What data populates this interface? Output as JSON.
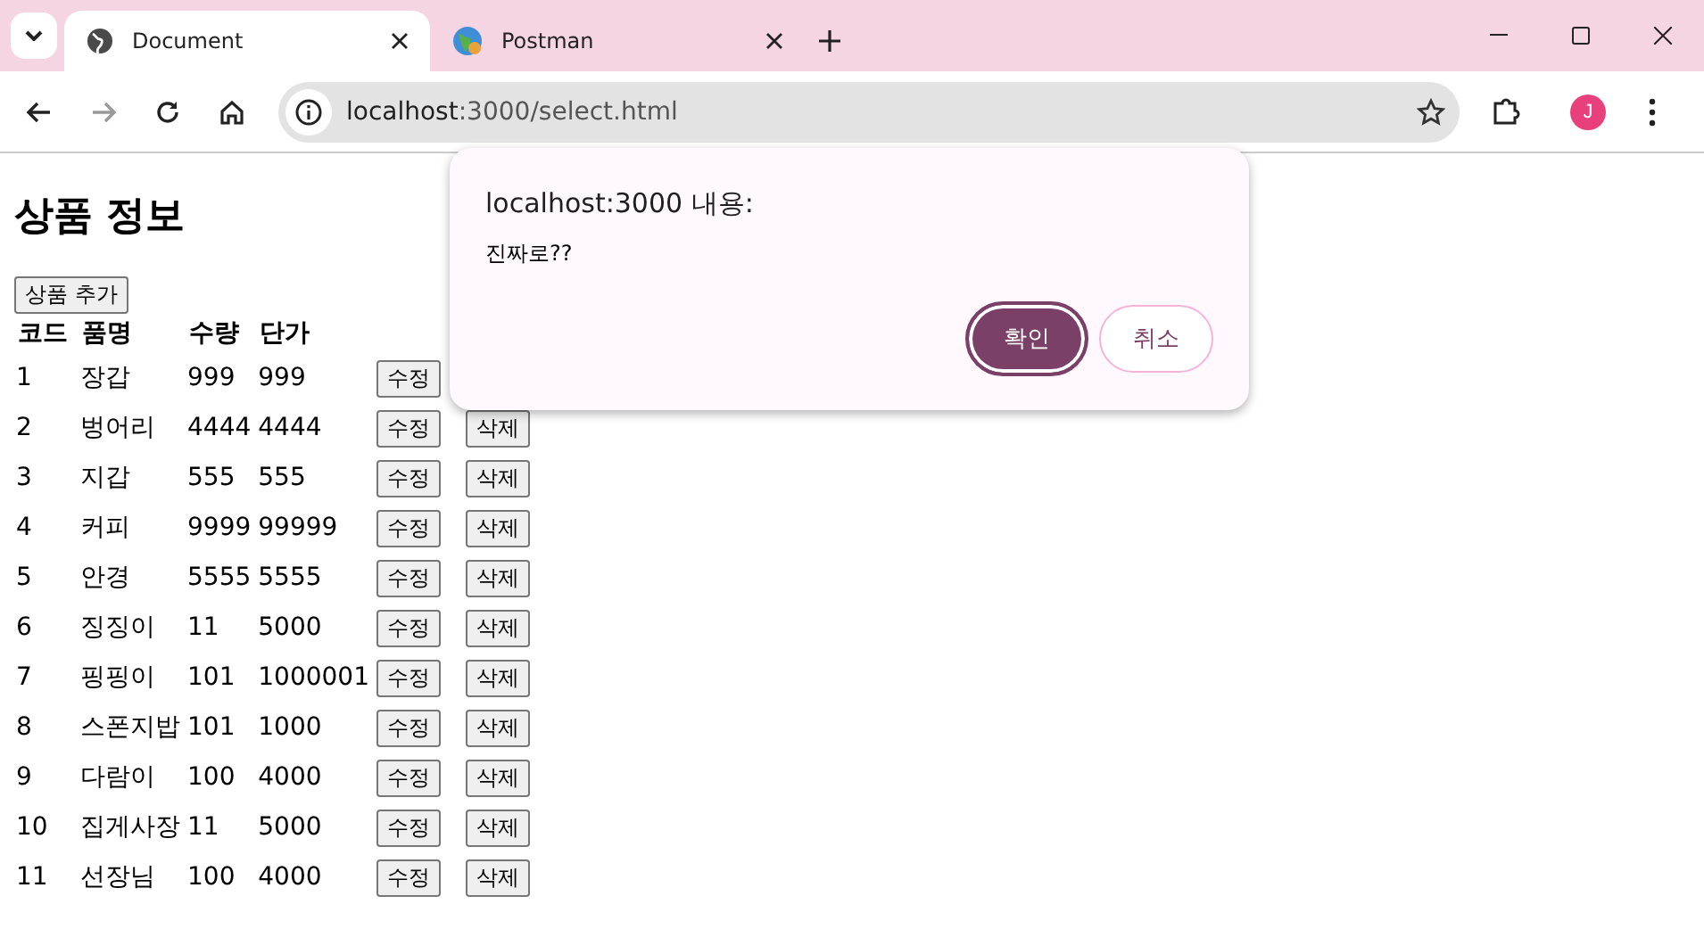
{
  "browser": {
    "tabs": [
      {
        "title": "Document",
        "selected": true,
        "kind": "globe"
      },
      {
        "title": "Postman",
        "selected": false,
        "kind": "earth"
      }
    ],
    "url_host": "localhost",
    "url_path": ":3000/select.html",
    "profile_initial": "J"
  },
  "page": {
    "heading": "상품 정보",
    "add_button": "상품 추가",
    "columns": [
      "코드",
      "품명",
      "수량",
      "단가"
    ],
    "rows": [
      {
        "code": "1",
        "name": "장갑",
        "qty": "999",
        "price": "999",
        "edit": "수정"
      },
      {
        "code": "2",
        "name": "벙어리",
        "qty": "4444",
        "price": "4444",
        "edit": "수정",
        "delete": "삭제"
      },
      {
        "code": "3",
        "name": "지갑",
        "qty": "555",
        "price": "555",
        "edit": "수정",
        "delete": "삭제"
      },
      {
        "code": "4",
        "name": "커피",
        "qty": "9999",
        "price": "99999",
        "edit": "수정",
        "delete": "삭제"
      },
      {
        "code": "5",
        "name": "안경",
        "qty": "5555",
        "price": "5555",
        "edit": "수정",
        "delete": "삭제"
      },
      {
        "code": "6",
        "name": "징징이",
        "qty": "11",
        "price": "5000",
        "edit": "수정",
        "delete": "삭제"
      },
      {
        "code": "7",
        "name": "핑핑이",
        "qty": "101",
        "price": "1000001",
        "edit": "수정",
        "delete": "삭제"
      },
      {
        "code": "8",
        "name": "스폰지밥",
        "qty": "101",
        "price": "1000",
        "edit": "수정",
        "delete": "삭제"
      },
      {
        "code": "9",
        "name": "다람이",
        "qty": "100",
        "price": "4000",
        "edit": "수정",
        "delete": "삭제"
      },
      {
        "code": "10",
        "name": "집게사장",
        "qty": "11",
        "price": "5000",
        "edit": "수정",
        "delete": "삭제"
      },
      {
        "code": "11",
        "name": "선장님",
        "qty": "100",
        "price": "4000",
        "edit": "수정",
        "delete": "삭제"
      }
    ]
  },
  "dialog": {
    "title": "localhost:3000 내용:",
    "message": "진짜로??",
    "ok": "확인",
    "cancel": "취소"
  }
}
